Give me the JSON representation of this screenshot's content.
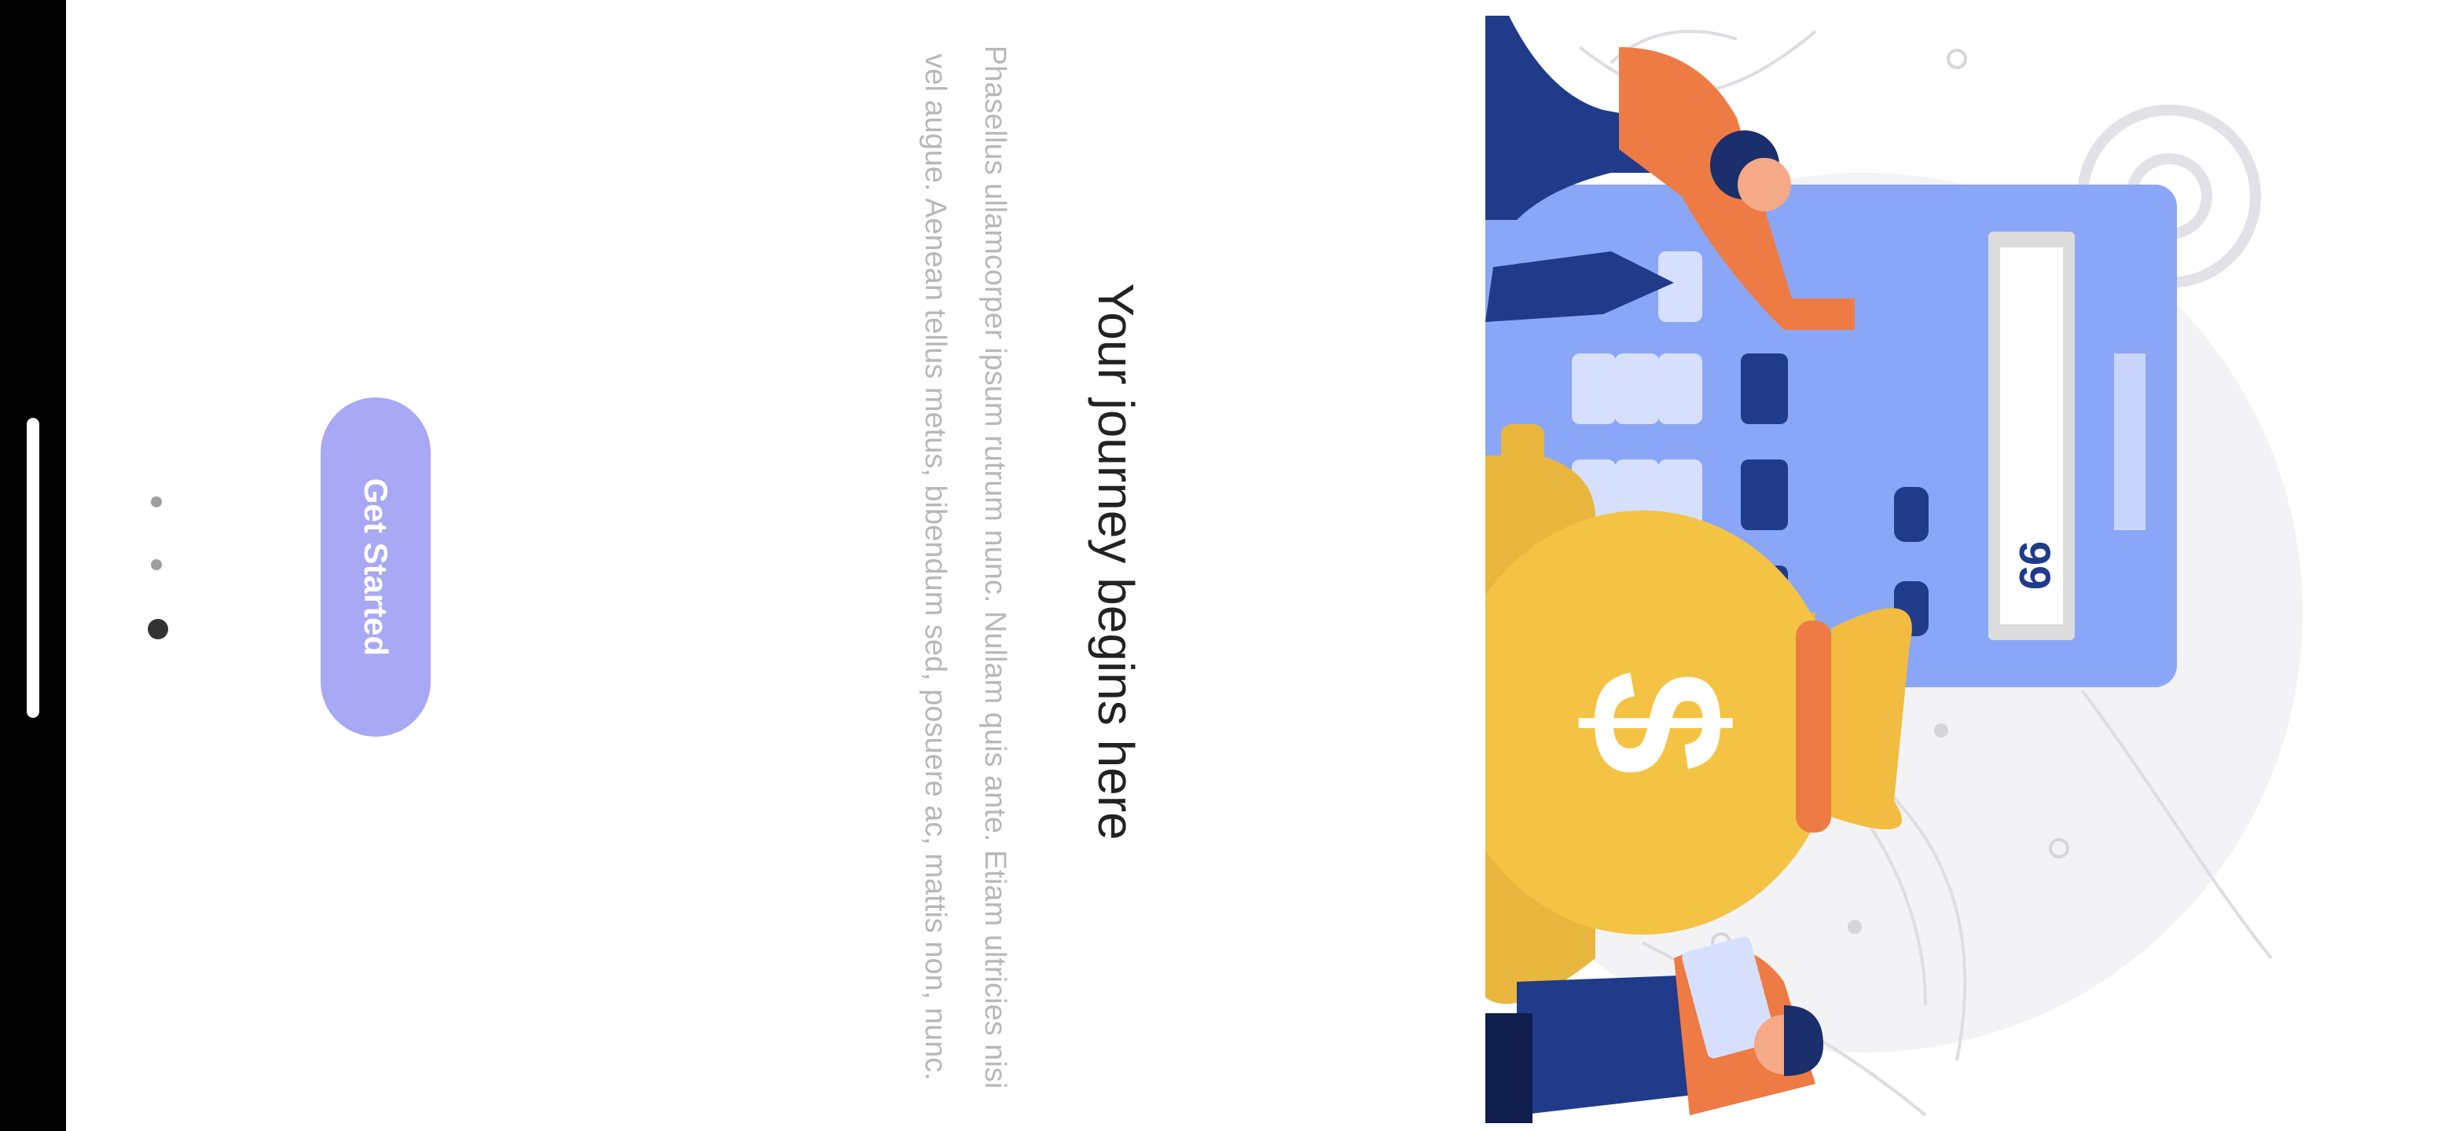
{
  "onboarding": {
    "title": "Your journey begins here",
    "description": "Phasellus ullamcorper ipsum rutrum nunc. Nullam quis ante. Etiam ultricies nisi vel augue. Aenean tellus metus, bibendum sed, posuere ac, mattis non, nunc.",
    "cta_label": "Get Started",
    "page_count": 3,
    "active_page": 3,
    "calculator_display": "99"
  },
  "colors": {
    "accent": "#a8a8f4",
    "calculator": "#8aa6f7",
    "money_bag": "#f5c344",
    "shirt": "#ee7a44",
    "pants": "#1f3b8a"
  }
}
